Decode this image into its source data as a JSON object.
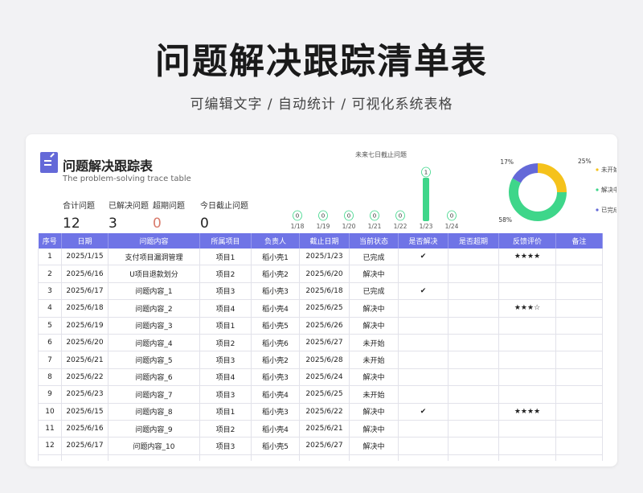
{
  "page": {
    "title": "问题解决跟踪清单表",
    "subtitle": "可编辑文字 / 自动统计 / 可视化系统表格"
  },
  "card": {
    "title": "问题解决跟踪表",
    "subtitle": "The problem-solving trace table"
  },
  "stats": [
    {
      "label": "合计问题",
      "value": "12"
    },
    {
      "label": "已解决问题",
      "value": "3"
    },
    {
      "label": "超期问题",
      "value": "0"
    },
    {
      "label": "今日截止问题",
      "value": "0"
    }
  ],
  "colors": {
    "accent": "#6f74e6",
    "bar": "#3ed68a",
    "overdue": "#d97b6c",
    "not_started": "#f5c21b",
    "in_progress": "#3ed68a",
    "done": "#6469d8"
  },
  "chart_data": [
    {
      "type": "bar",
      "title": "未来七日截止问题",
      "categories": [
        "1/18",
        "1/19",
        "1/20",
        "1/21",
        "1/22",
        "1/23",
        "1/24"
      ],
      "values": [
        0,
        0,
        0,
        0,
        0,
        1,
        0
      ],
      "ylim": [
        0,
        1
      ]
    },
    {
      "type": "pie",
      "legend": [
        "未开始",
        "解决中",
        "已完成"
      ],
      "values": [
        25,
        58,
        17
      ],
      "labels": [
        "25%",
        "58%",
        "17%"
      ]
    }
  ],
  "table": {
    "headers": [
      "序号",
      "日期",
      "问题内容",
      "所属项目",
      "负责人",
      "截止日期",
      "当前状态",
      "是否解决",
      "是否超期",
      "反馈评价",
      "备注"
    ],
    "rows": [
      [
        "1",
        "2025/1/15",
        "支付项目漏洞管理",
        "项目1",
        "稻小壳1",
        "2025/1/23",
        "已完成",
        "✔",
        "",
        "★★★★",
        ""
      ],
      [
        "2",
        "2025/6/16",
        "U项目退款划分",
        "项目2",
        "稻小壳2",
        "2025/6/20",
        "解决中",
        "",
        "",
        "",
        ""
      ],
      [
        "3",
        "2025/6/17",
        "问题内容_1",
        "项目3",
        "稻小壳3",
        "2025/6/18",
        "已完成",
        "✔",
        "",
        "",
        ""
      ],
      [
        "4",
        "2025/6/18",
        "问题内容_2",
        "项目4",
        "稻小壳4",
        "2025/6/25",
        "解决中",
        "",
        "",
        "★★★☆",
        ""
      ],
      [
        "5",
        "2025/6/19",
        "问题内容_3",
        "项目1",
        "稻小壳5",
        "2025/6/26",
        "解决中",
        "",
        "",
        "",
        ""
      ],
      [
        "6",
        "2025/6/20",
        "问题内容_4",
        "项目2",
        "稻小壳6",
        "2025/6/27",
        "未开始",
        "",
        "",
        "",
        ""
      ],
      [
        "7",
        "2025/6/21",
        "问题内容_5",
        "项目3",
        "稻小壳2",
        "2025/6/28",
        "未开始",
        "",
        "",
        "",
        ""
      ],
      [
        "8",
        "2025/6/22",
        "问题内容_6",
        "项目4",
        "稻小壳3",
        "2025/6/24",
        "解决中",
        "",
        "",
        "",
        ""
      ],
      [
        "9",
        "2025/6/23",
        "问题内容_7",
        "项目3",
        "稻小壳4",
        "2025/6/25",
        "未开始",
        "",
        "",
        "",
        ""
      ],
      [
        "10",
        "2025/6/15",
        "问题内容_8",
        "项目1",
        "稻小壳3",
        "2025/6/22",
        "解决中",
        "✔",
        "",
        "★★★★",
        ""
      ],
      [
        "11",
        "2025/6/16",
        "问题内容_9",
        "项目2",
        "稻小壳4",
        "2025/6/21",
        "解决中",
        "",
        "",
        "",
        ""
      ],
      [
        "12",
        "2025/6/17",
        "问题内容_10",
        "项目3",
        "稻小壳5",
        "2025/6/27",
        "解决中",
        "",
        "",
        "",
        ""
      ]
    ]
  }
}
